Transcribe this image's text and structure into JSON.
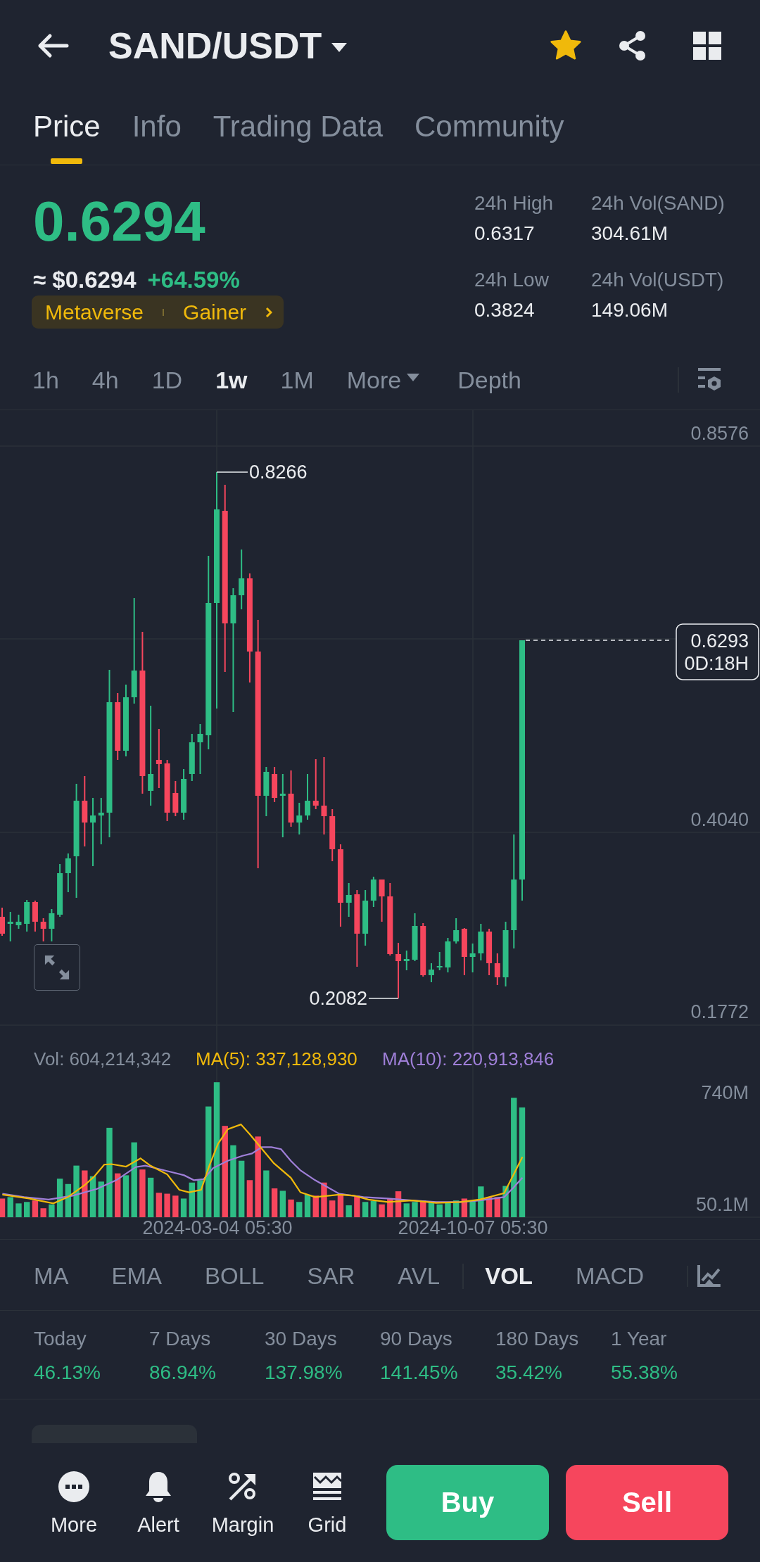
{
  "header": {
    "title": "SAND/USDT",
    "favorite": true
  },
  "tabs": [
    {
      "label": "Price",
      "selected": true
    },
    {
      "label": "Info",
      "selected": false
    },
    {
      "label": "Trading Data",
      "selected": false
    },
    {
      "label": "Community",
      "selected": false
    }
  ],
  "ticker": {
    "price": "0.6294",
    "fiat_price": "≈ $0.6294",
    "change": "+64.59%",
    "tags": [
      "Metaverse",
      "Gainer"
    ],
    "stats": [
      {
        "label": "24h High",
        "value": "0.6317"
      },
      {
        "label": "24h Vol(SAND)",
        "value": "304.61M"
      },
      {
        "label": "24h Low",
        "value": "0.3824"
      },
      {
        "label": "24h Vol(USDT)",
        "value": "149.06M"
      }
    ]
  },
  "intervals": [
    {
      "label": "1h",
      "kind": "interval",
      "selected": false
    },
    {
      "label": "4h",
      "kind": "interval",
      "selected": false
    },
    {
      "label": "1D",
      "kind": "interval",
      "selected": false
    },
    {
      "label": "1w",
      "kind": "interval",
      "selected": true
    },
    {
      "label": "1M",
      "kind": "interval",
      "selected": false
    },
    {
      "label": "More",
      "kind": "menu",
      "selected": false
    },
    {
      "label": "Depth",
      "kind": "view",
      "selected": false
    }
  ],
  "chart": {
    "price_ticks": [
      "0.8576",
      "0.4040",
      "0.1772"
    ],
    "high_label": "0.8266",
    "low_label": "0.2082",
    "last_price": "0.6293",
    "countdown": "0D:18H"
  },
  "volume": {
    "legend": [
      {
        "text": "Vol: 604,214,342",
        "color": "#848e9c"
      },
      {
        "text": "MA(5): 337,128,930",
        "color": "#f0b90b"
      },
      {
        "text": "MA(10): 220,913,846",
        "color": "#9f7fd8"
      }
    ],
    "ticks": [
      "740M",
      "50.1M"
    ],
    "dates": [
      "2024-03-04 05:30",
      "2024-10-07 05:30"
    ]
  },
  "indicator_groups": [
    {
      "items": [
        {
          "label": "MA",
          "selected": false
        },
        {
          "label": "EMA",
          "selected": false
        },
        {
          "label": "BOLL",
          "selected": false
        },
        {
          "label": "SAR",
          "selected": false
        },
        {
          "label": "AVL",
          "selected": false
        }
      ]
    },
    {
      "items": [
        {
          "label": "VOL",
          "selected": true
        },
        {
          "label": "MACD",
          "selected": false
        }
      ]
    }
  ],
  "performance": [
    {
      "label": "Today",
      "value": "46.13%"
    },
    {
      "label": "7 Days",
      "value": "86.94%"
    },
    {
      "label": "30 Days",
      "value": "137.98%"
    },
    {
      "label": "90 Days",
      "value": "141.45%"
    },
    {
      "label": "180 Days",
      "value": "35.42%"
    },
    {
      "label": "1 Year",
      "value": "55.38%"
    }
  ],
  "bottom_bar": {
    "actions": [
      {
        "label": "More",
        "kind": "more"
      },
      {
        "label": "Alert",
        "kind": "alert"
      },
      {
        "label": "Margin",
        "kind": "margin"
      },
      {
        "label": "Grid",
        "kind": "grid"
      }
    ],
    "buy": "Buy",
    "sell": "Sell"
  }
}
